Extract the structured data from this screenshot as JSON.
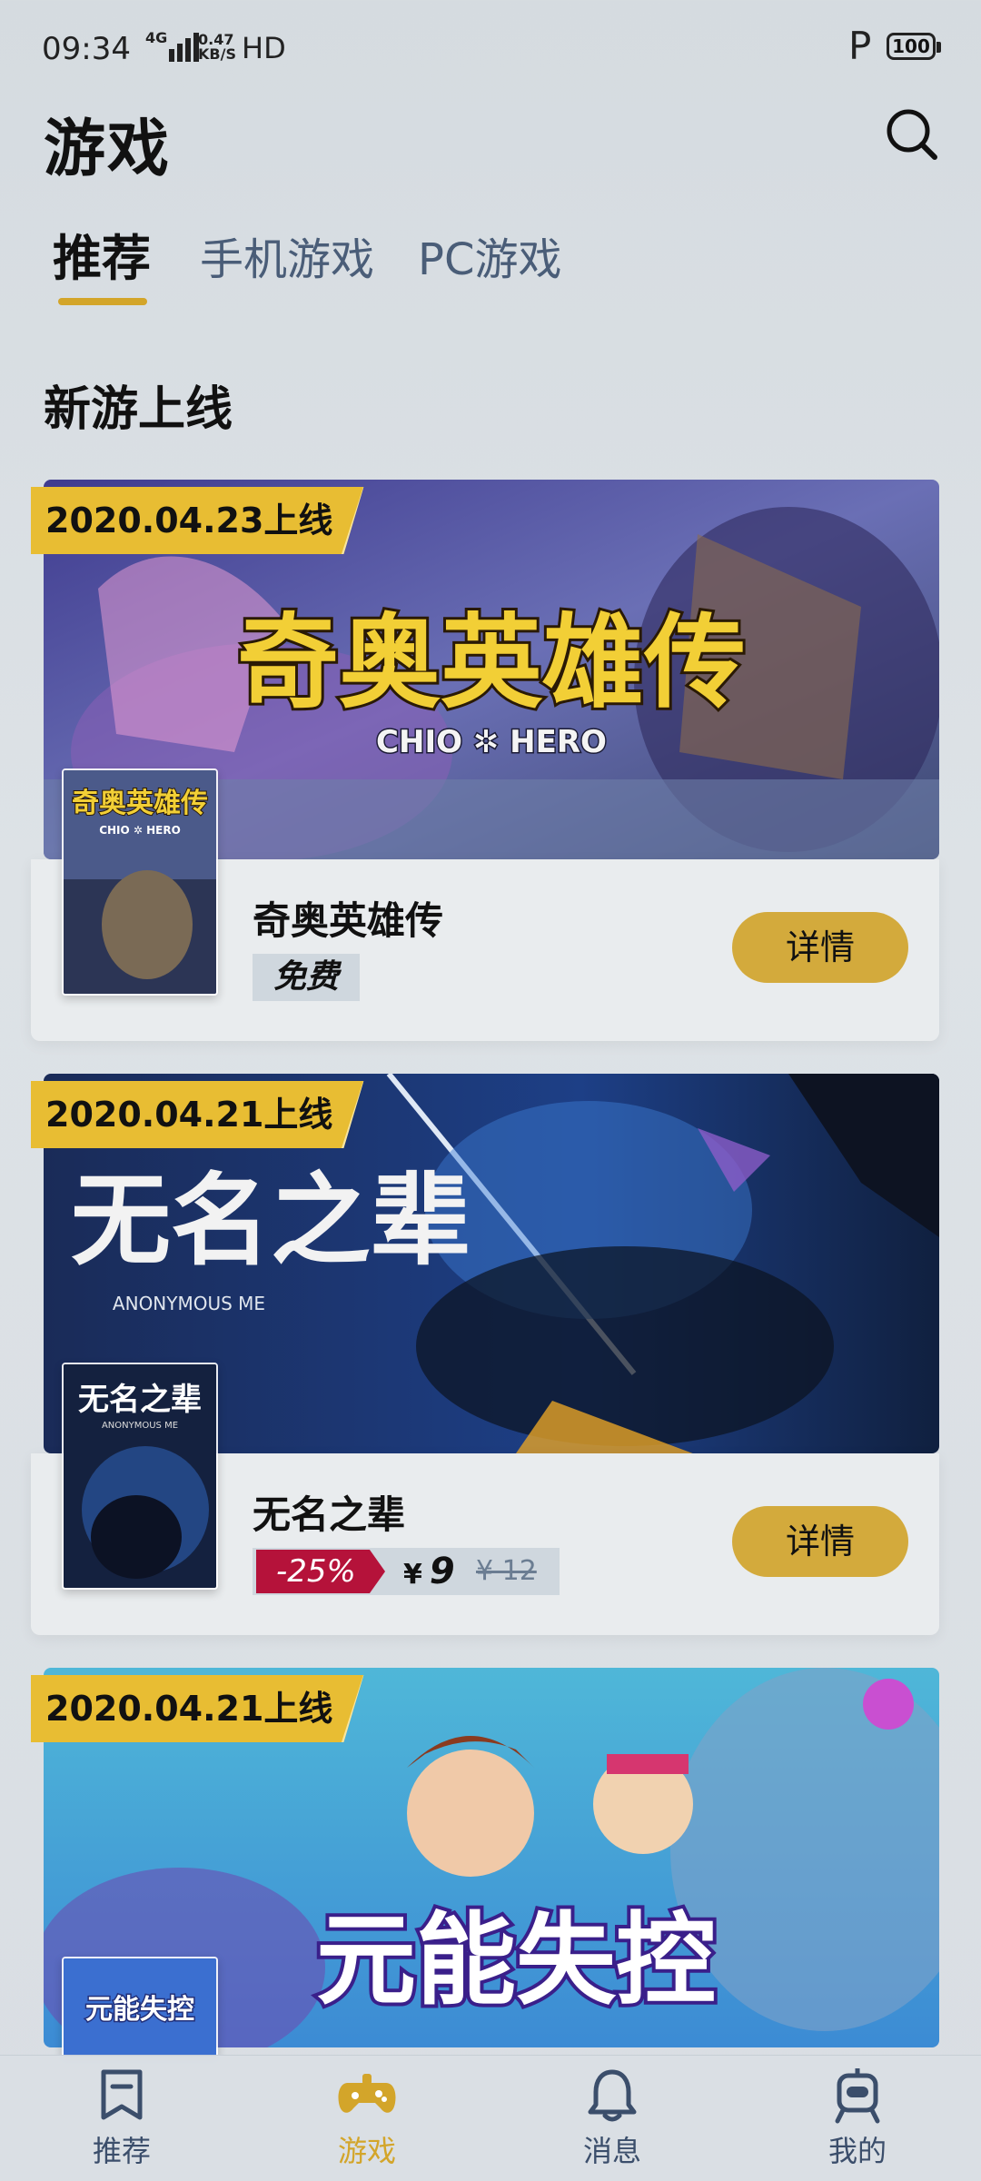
{
  "status_bar": {
    "time": "09:34",
    "network": "4G",
    "speed_value": "0.47",
    "speed_unit": "KB/S",
    "hd": "HD",
    "p_label": "P",
    "battery": "100"
  },
  "header": {
    "title": "游戏"
  },
  "tabs": [
    {
      "label": "推荐",
      "active": true
    },
    {
      "label": "手机游戏",
      "active": false
    },
    {
      "label": "PC游戏",
      "active": false
    }
  ],
  "section": {
    "title": "新游上线"
  },
  "games": [
    {
      "date": "2020.04.23上线",
      "name": "奇奥英雄传",
      "price_label": "免费",
      "detail_label": "详情",
      "banner_title": "奇奥英雄传",
      "banner_subtitle": "CHIO ✲ HERO",
      "cover_title": "奇奥英雄传",
      "cover_subtitle": "CHIO ✲ HERO"
    },
    {
      "date": "2020.04.21上线",
      "name": "无名之辈",
      "discount": "-25%",
      "currency": "¥",
      "price_now": "9",
      "price_old": "¥ 12",
      "detail_label": "详情",
      "banner_title": "无名之辈",
      "banner_subtitle": "ANONYMOUS ME",
      "cover_title": "无名之辈",
      "cover_subtitle": "ANONYMOUS ME"
    },
    {
      "date": "2020.04.21上线",
      "banner_title": "元能失控",
      "cover_title": "元能失控"
    }
  ],
  "bottom_nav": [
    {
      "label": "推荐",
      "icon": "bookmark-icon",
      "active": false
    },
    {
      "label": "游戏",
      "icon": "gamepad-icon",
      "active": true
    },
    {
      "label": "消息",
      "icon": "bell-icon",
      "active": false
    },
    {
      "label": "我的",
      "icon": "robot-avatar-icon",
      "active": false
    }
  ],
  "colors": {
    "accent": "#d3a52a",
    "badge": "#e8bd33",
    "discount": "#b5123a",
    "nav_inactive": "#3b4e6b"
  }
}
